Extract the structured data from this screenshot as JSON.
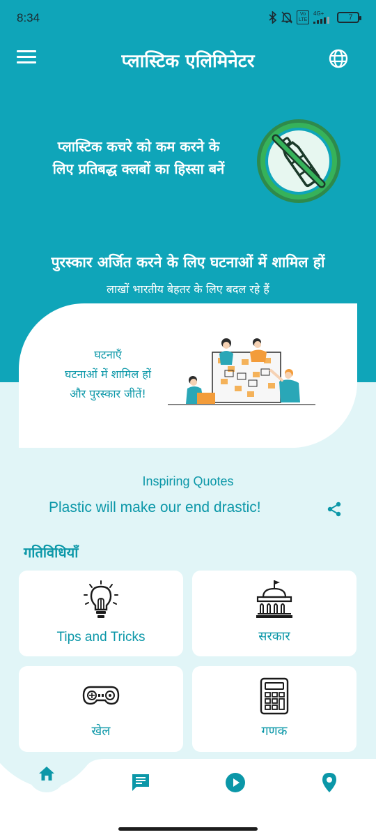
{
  "status_bar": {
    "time": "8:34",
    "network": "4G+",
    "volte": "Vo LTE",
    "battery": "7"
  },
  "app_bar": {
    "title": "प्लास्टिक एलिमिनेटर"
  },
  "hero": {
    "line1": "प्लास्टिक कचरे को कम करने के",
    "line2": "लिए प्रतिबद्ध क्लबों का हिस्सा बनें"
  },
  "events": {
    "heading": "पुरस्कार अर्जित करने के लिए घटनाओं में शामिल हों",
    "subheading": "लाखों भारतीय बेहतर के लिए बदल रहे हैं",
    "card_lines": [
      "घटनाएँ",
      "घटनाओं में शामिल हों",
      "और पुरस्कार जीतें!"
    ]
  },
  "quotes": {
    "label": "Inspiring Quotes",
    "text": "Plastic will make our end drastic!"
  },
  "activities": {
    "title": "गतिविधियाँ",
    "tiles": [
      {
        "label": "Tips and Tricks",
        "icon": "lightbulb-icon"
      },
      {
        "label": "सरकार",
        "icon": "government-building-icon"
      },
      {
        "label": "खेल",
        "icon": "gamepad-icon"
      },
      {
        "label": "गणक",
        "icon": "calculator-icon"
      }
    ]
  },
  "bottom_nav": {
    "items": [
      "home-icon",
      "feedback-chat-icon",
      "play-icon",
      "location-pin-icon"
    ]
  },
  "colors": {
    "primary": "#0fa5b9",
    "accent_text": "#0b97a8",
    "background": "#e1f5f7",
    "icon_green": "#2fa84f"
  }
}
